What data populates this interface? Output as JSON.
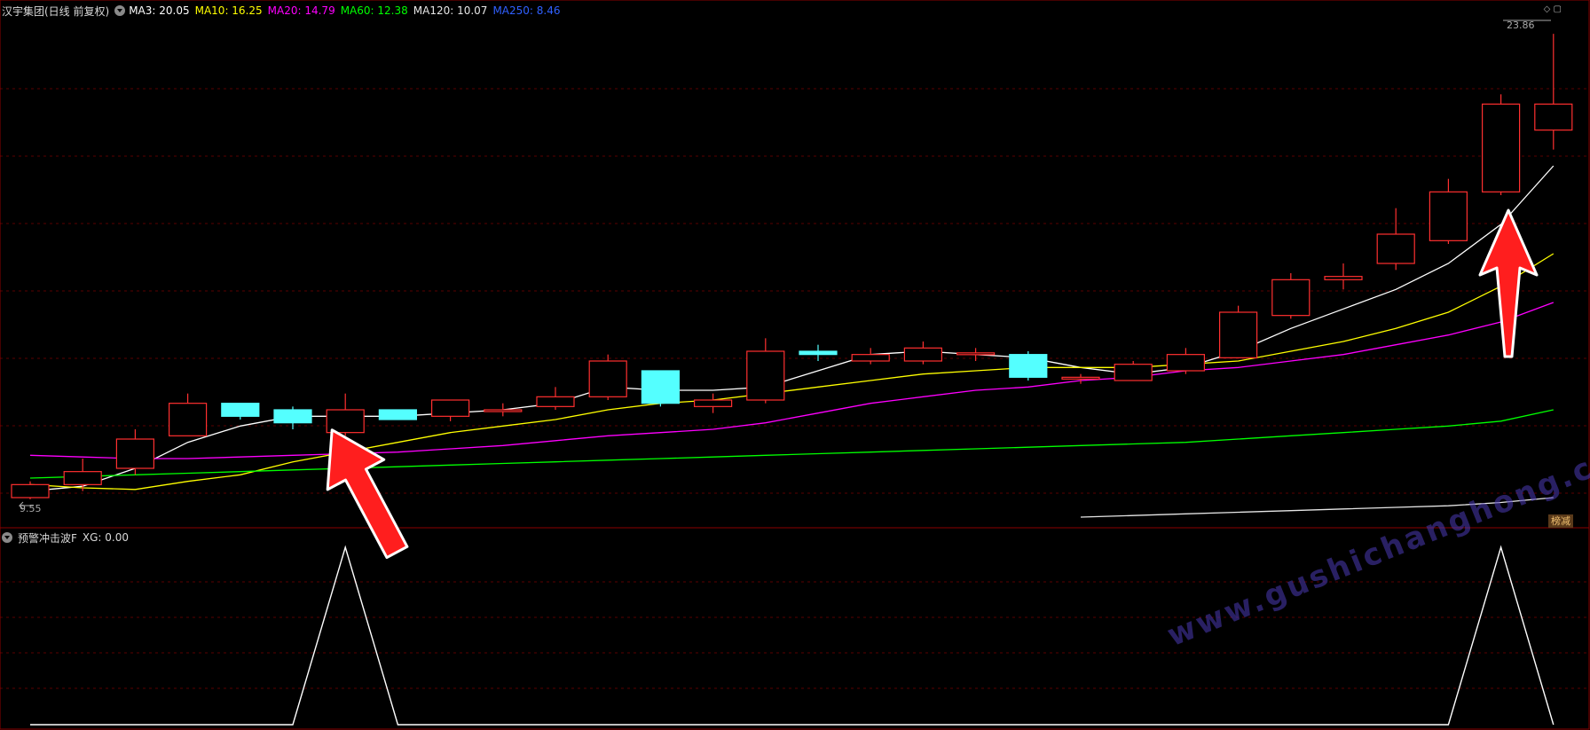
{
  "header": {
    "title": "汉宇集团(日线 前复权)",
    "ma_items": [
      {
        "label": "MA3: 20.05",
        "color": "#ffffff"
      },
      {
        "label": "MA10: 16.25",
        "color": "#ffff00"
      },
      {
        "label": "MA20: 14.79",
        "color": "#ff00ff"
      },
      {
        "label": "MA60: 12.38",
        "color": "#00ff00"
      },
      {
        "label": "MA120: 10.07",
        "color": "#e6e6e6"
      },
      {
        "label": "MA250: 8.46",
        "color": "#3060ff"
      }
    ]
  },
  "indicator_header": {
    "title": "预警冲击波F",
    "value_label": "XG: 0.00"
  },
  "max_price_label": "23.86",
  "min_price_label": "9.55",
  "badge": "榜减",
  "watermark": "www.gushichanghong.com",
  "chart_data": [
    {
      "type": "candlestick",
      "title": "汉宇集团(日线 前复权)",
      "ylim": [
        9.3,
        24.3
      ],
      "up_color": "#ff3030",
      "down_color": "#54ffff",
      "candles": [
        {
          "o": 9.6,
          "h": 10.1,
          "l": 9.55,
          "c": 10.0
        },
        {
          "o": 10.0,
          "h": 10.8,
          "l": 9.8,
          "c": 10.4
        },
        {
          "o": 10.5,
          "h": 11.7,
          "l": 10.3,
          "c": 11.4
        },
        {
          "o": 11.5,
          "h": 12.8,
          "l": 11.5,
          "c": 12.5
        },
        {
          "o": 12.5,
          "h": 12.5,
          "l": 12.0,
          "c": 12.1
        },
        {
          "o": 12.3,
          "h": 12.4,
          "l": 11.7,
          "c": 11.9
        },
        {
          "o": 11.6,
          "h": 12.8,
          "l": 11.5,
          "c": 12.3
        },
        {
          "o": 12.3,
          "h": 12.3,
          "l": 12.0,
          "c": 12.0
        },
        {
          "o": 12.1,
          "h": 12.6,
          "l": 11.95,
          "c": 12.6
        },
        {
          "o": 12.3,
          "h": 12.5,
          "l": 12.1,
          "c": 12.3
        },
        {
          "o": 12.4,
          "h": 13.0,
          "l": 12.3,
          "c": 12.7
        },
        {
          "o": 12.7,
          "h": 14.0,
          "l": 12.6,
          "c": 13.8
        },
        {
          "o": 13.5,
          "h": 13.5,
          "l": 12.4,
          "c": 12.5
        },
        {
          "o": 12.4,
          "h": 12.8,
          "l": 12.2,
          "c": 12.6
        },
        {
          "o": 12.6,
          "h": 14.5,
          "l": 12.5,
          "c": 14.1
        },
        {
          "o": 14.1,
          "h": 14.3,
          "l": 13.8,
          "c": 14.0
        },
        {
          "o": 13.8,
          "h": 14.2,
          "l": 13.7,
          "c": 14.0
        },
        {
          "o": 13.8,
          "h": 14.4,
          "l": 13.7,
          "c": 14.2
        },
        {
          "o": 14.0,
          "h": 14.2,
          "l": 13.8,
          "c": 14.05
        },
        {
          "o": 14.0,
          "h": 14.1,
          "l": 13.2,
          "c": 13.3
        },
        {
          "o": 13.3,
          "h": 13.4,
          "l": 13.1,
          "c": 13.3
        },
        {
          "o": 13.2,
          "h": 13.8,
          "l": 13.2,
          "c": 13.7
        },
        {
          "o": 13.5,
          "h": 14.2,
          "l": 13.4,
          "c": 14.0
        },
        {
          "o": 13.9,
          "h": 15.5,
          "l": 13.9,
          "c": 15.3
        },
        {
          "o": 15.2,
          "h": 16.5,
          "l": 15.1,
          "c": 16.3
        },
        {
          "o": 16.3,
          "h": 16.8,
          "l": 16.0,
          "c": 16.4
        },
        {
          "o": 16.8,
          "h": 18.5,
          "l": 16.6,
          "c": 17.7
        },
        {
          "o": 17.5,
          "h": 19.4,
          "l": 17.4,
          "c": 19.0
        },
        {
          "o": 19.0,
          "h": 22.0,
          "l": 18.9,
          "c": 21.7
        },
        {
          "o": 20.9,
          "h": 23.86,
          "l": 20.3,
          "c": 21.7
        }
      ],
      "ma_series": [
        {
          "name": "MA3",
          "color": "#ffffff",
          "start": 0,
          "values": [
            9.8,
            9.95,
            10.5,
            11.3,
            11.8,
            12.1,
            12.1,
            12.1,
            12.2,
            12.3,
            12.5,
            13.0,
            12.9,
            12.9,
            13.0,
            13.5,
            14.0,
            14.1,
            14.0,
            13.9,
            13.6,
            13.4,
            13.6,
            14.1,
            14.8,
            15.4,
            16.0,
            16.8,
            18.0,
            19.8
          ]
        },
        {
          "name": "MA10",
          "color": "#ffff00",
          "start": 0,
          "values": [
            10.0,
            9.9,
            9.85,
            10.1,
            10.3,
            10.7,
            11.0,
            11.3,
            11.6,
            11.8,
            12.0,
            12.3,
            12.5,
            12.6,
            12.8,
            13.0,
            13.2,
            13.4,
            13.5,
            13.6,
            13.6,
            13.6,
            13.7,
            13.8,
            14.1,
            14.4,
            14.8,
            15.3,
            16.1,
            17.1
          ]
        },
        {
          "name": "MA20",
          "color": "#ff00ff",
          "start": 0,
          "values": [
            10.9,
            10.85,
            10.8,
            10.8,
            10.85,
            10.9,
            10.95,
            11.0,
            11.1,
            11.2,
            11.35,
            11.5,
            11.6,
            11.7,
            11.9,
            12.2,
            12.5,
            12.7,
            12.9,
            13.0,
            13.2,
            13.3,
            13.5,
            13.6,
            13.8,
            14.0,
            14.3,
            14.6,
            15.0,
            15.6
          ]
        },
        {
          "name": "MA60",
          "color": "#00ff00",
          "start": 0,
          "values": [
            10.2,
            10.25,
            10.3,
            10.35,
            10.4,
            10.45,
            10.5,
            10.55,
            10.6,
            10.65,
            10.7,
            10.75,
            10.8,
            10.85,
            10.9,
            10.95,
            11.0,
            11.05,
            11.1,
            11.15,
            11.2,
            11.25,
            11.3,
            11.4,
            11.5,
            11.6,
            11.7,
            11.8,
            11.95,
            12.3
          ]
        },
        {
          "name": "MA120",
          "color": "#e6e6e6",
          "start": 20,
          "values": [
            9.0,
            9.05,
            9.1,
            9.15,
            9.2,
            9.25,
            9.3,
            9.35,
            9.45,
            9.6
          ]
        }
      ]
    },
    {
      "type": "line",
      "title": "预警冲击波F",
      "series": [
        {
          "name": "XG",
          "color": "#ffffff",
          "values": [
            0,
            0,
            0,
            0,
            0,
            0,
            1,
            0,
            0,
            0,
            0,
            0,
            0,
            0,
            0,
            0,
            0,
            0,
            0,
            0,
            0,
            0,
            0,
            0,
            0,
            0,
            0,
            0,
            1,
            0
          ]
        }
      ],
      "ylim": [
        0,
        1
      ]
    }
  ]
}
